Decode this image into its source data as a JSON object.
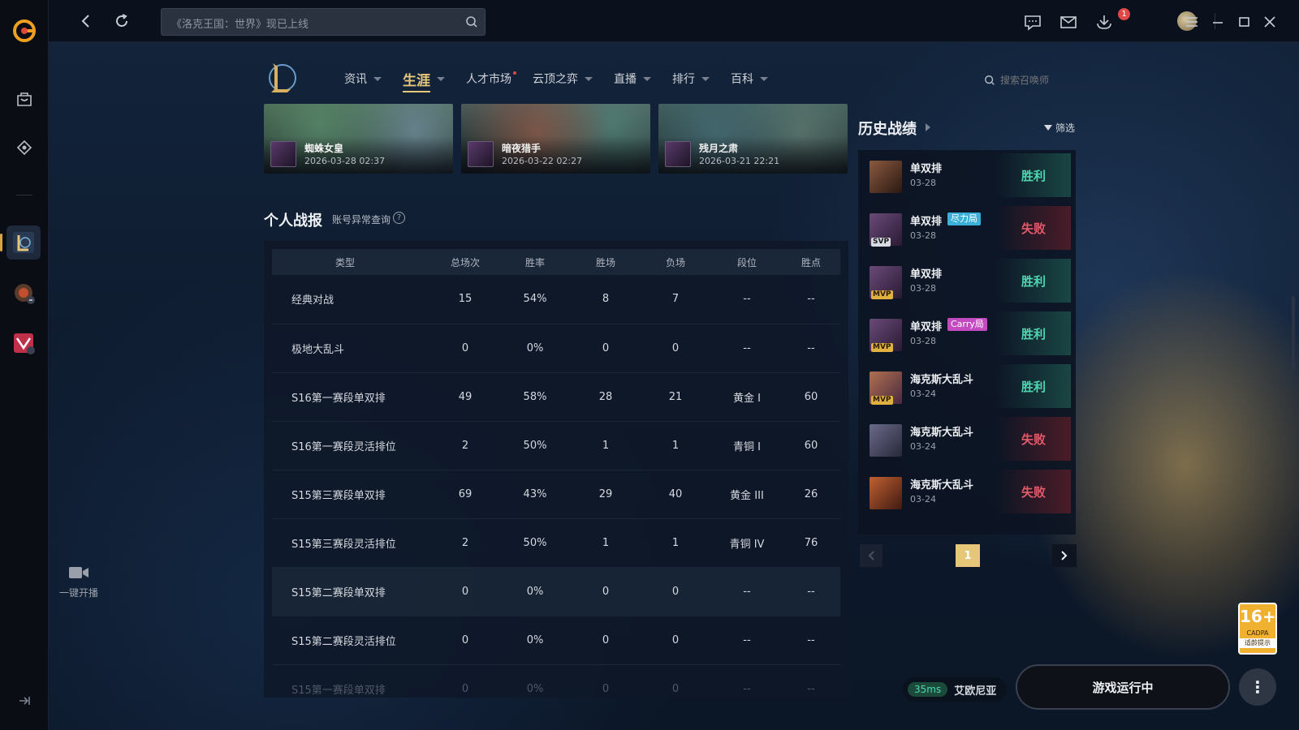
{
  "search": {
    "placeholder": "《洛克王国：世界》现已上线"
  },
  "topbar": {
    "mail_badge": "1"
  },
  "rail": {
    "live_label": "一键开播"
  },
  "nav": {
    "items": [
      {
        "label": "资讯"
      },
      {
        "label": "生涯"
      },
      {
        "label": "人才市场"
      },
      {
        "label": "云顶之弈"
      },
      {
        "label": "直播"
      },
      {
        "label": "排行"
      },
      {
        "label": "百科"
      }
    ],
    "summoner_search_placeholder": "搜索召唤师"
  },
  "recent_cards": [
    {
      "champion": "蜘蛛女皇",
      "date": "2026-03-28 02:37"
    },
    {
      "champion": "暗夜猎手",
      "date": "2026-03-22 02:27"
    },
    {
      "champion": "残月之肃",
      "date": "2026-03-21 22:21"
    }
  ],
  "report": {
    "title": "个人战报",
    "abnormal_link": "账号异常查询",
    "help": "?",
    "columns": [
      "类型",
      "总场次",
      "胜率",
      "胜场",
      "负场",
      "段位",
      "胜点"
    ],
    "rows": [
      [
        "经典对战",
        "15",
        "54%",
        "8",
        "7",
        "--",
        "--"
      ],
      [
        "极地大乱斗",
        "0",
        "0%",
        "0",
        "0",
        "--",
        "--"
      ],
      [
        "S16第一赛段单双排",
        "49",
        "58%",
        "28",
        "21",
        "黄金 I",
        "60"
      ],
      [
        "S16第一赛段灵活排位",
        "2",
        "50%",
        "1",
        "1",
        "青铜 I",
        "60"
      ],
      [
        "S15第三赛段单双排",
        "69",
        "43%",
        "29",
        "40",
        "黄金 III",
        "26"
      ],
      [
        "S15第三赛段灵活排位",
        "2",
        "50%",
        "1",
        "1",
        "青铜 IV",
        "76"
      ],
      [
        "S15第二赛段单双排",
        "0",
        "0%",
        "0",
        "0",
        "--",
        "--"
      ],
      [
        "S15第二赛段灵活排位",
        "0",
        "0%",
        "0",
        "0",
        "--",
        "--"
      ],
      [
        "S15第一赛段单双排",
        "0",
        "0%",
        "0",
        "0",
        "--",
        "--"
      ]
    ]
  },
  "history": {
    "title": "历史战绩",
    "filter": "筛选",
    "matches": [
      {
        "mode": "单双排",
        "date": "03-28",
        "result": "胜利",
        "win": true,
        "tag": "",
        "label": ""
      },
      {
        "mode": "单双排",
        "date": "03-28",
        "result": "失败",
        "win": false,
        "tag": "SVP",
        "label": "尽力局"
      },
      {
        "mode": "单双排",
        "date": "03-28",
        "result": "胜利",
        "win": true,
        "tag": "MVP",
        "label": ""
      },
      {
        "mode": "单双排",
        "date": "03-28",
        "result": "胜利",
        "win": true,
        "tag": "MVP",
        "label": "Carry局"
      },
      {
        "mode": "海克斯大乱斗",
        "date": "03-24",
        "result": "胜利",
        "win": true,
        "tag": "MVP",
        "label": ""
      },
      {
        "mode": "海克斯大乱斗",
        "date": "03-24",
        "result": "失败",
        "win": false,
        "tag": "",
        "label": ""
      },
      {
        "mode": "海克斯大乱斗",
        "date": "03-24",
        "result": "失败",
        "win": false,
        "tag": "",
        "label": ""
      }
    ],
    "page": "1"
  },
  "status": {
    "ping": "35ms",
    "server": "艾欧尼亚",
    "play_button": "游戏运行中",
    "more": "⋮"
  },
  "age_rating": {
    "age": "16+",
    "org": "CADPA",
    "tip": "适龄提示"
  },
  "colors": {
    "accent_gold": "#e6c77a",
    "win": "#4fd6b0",
    "lose": "#e45a6a"
  }
}
